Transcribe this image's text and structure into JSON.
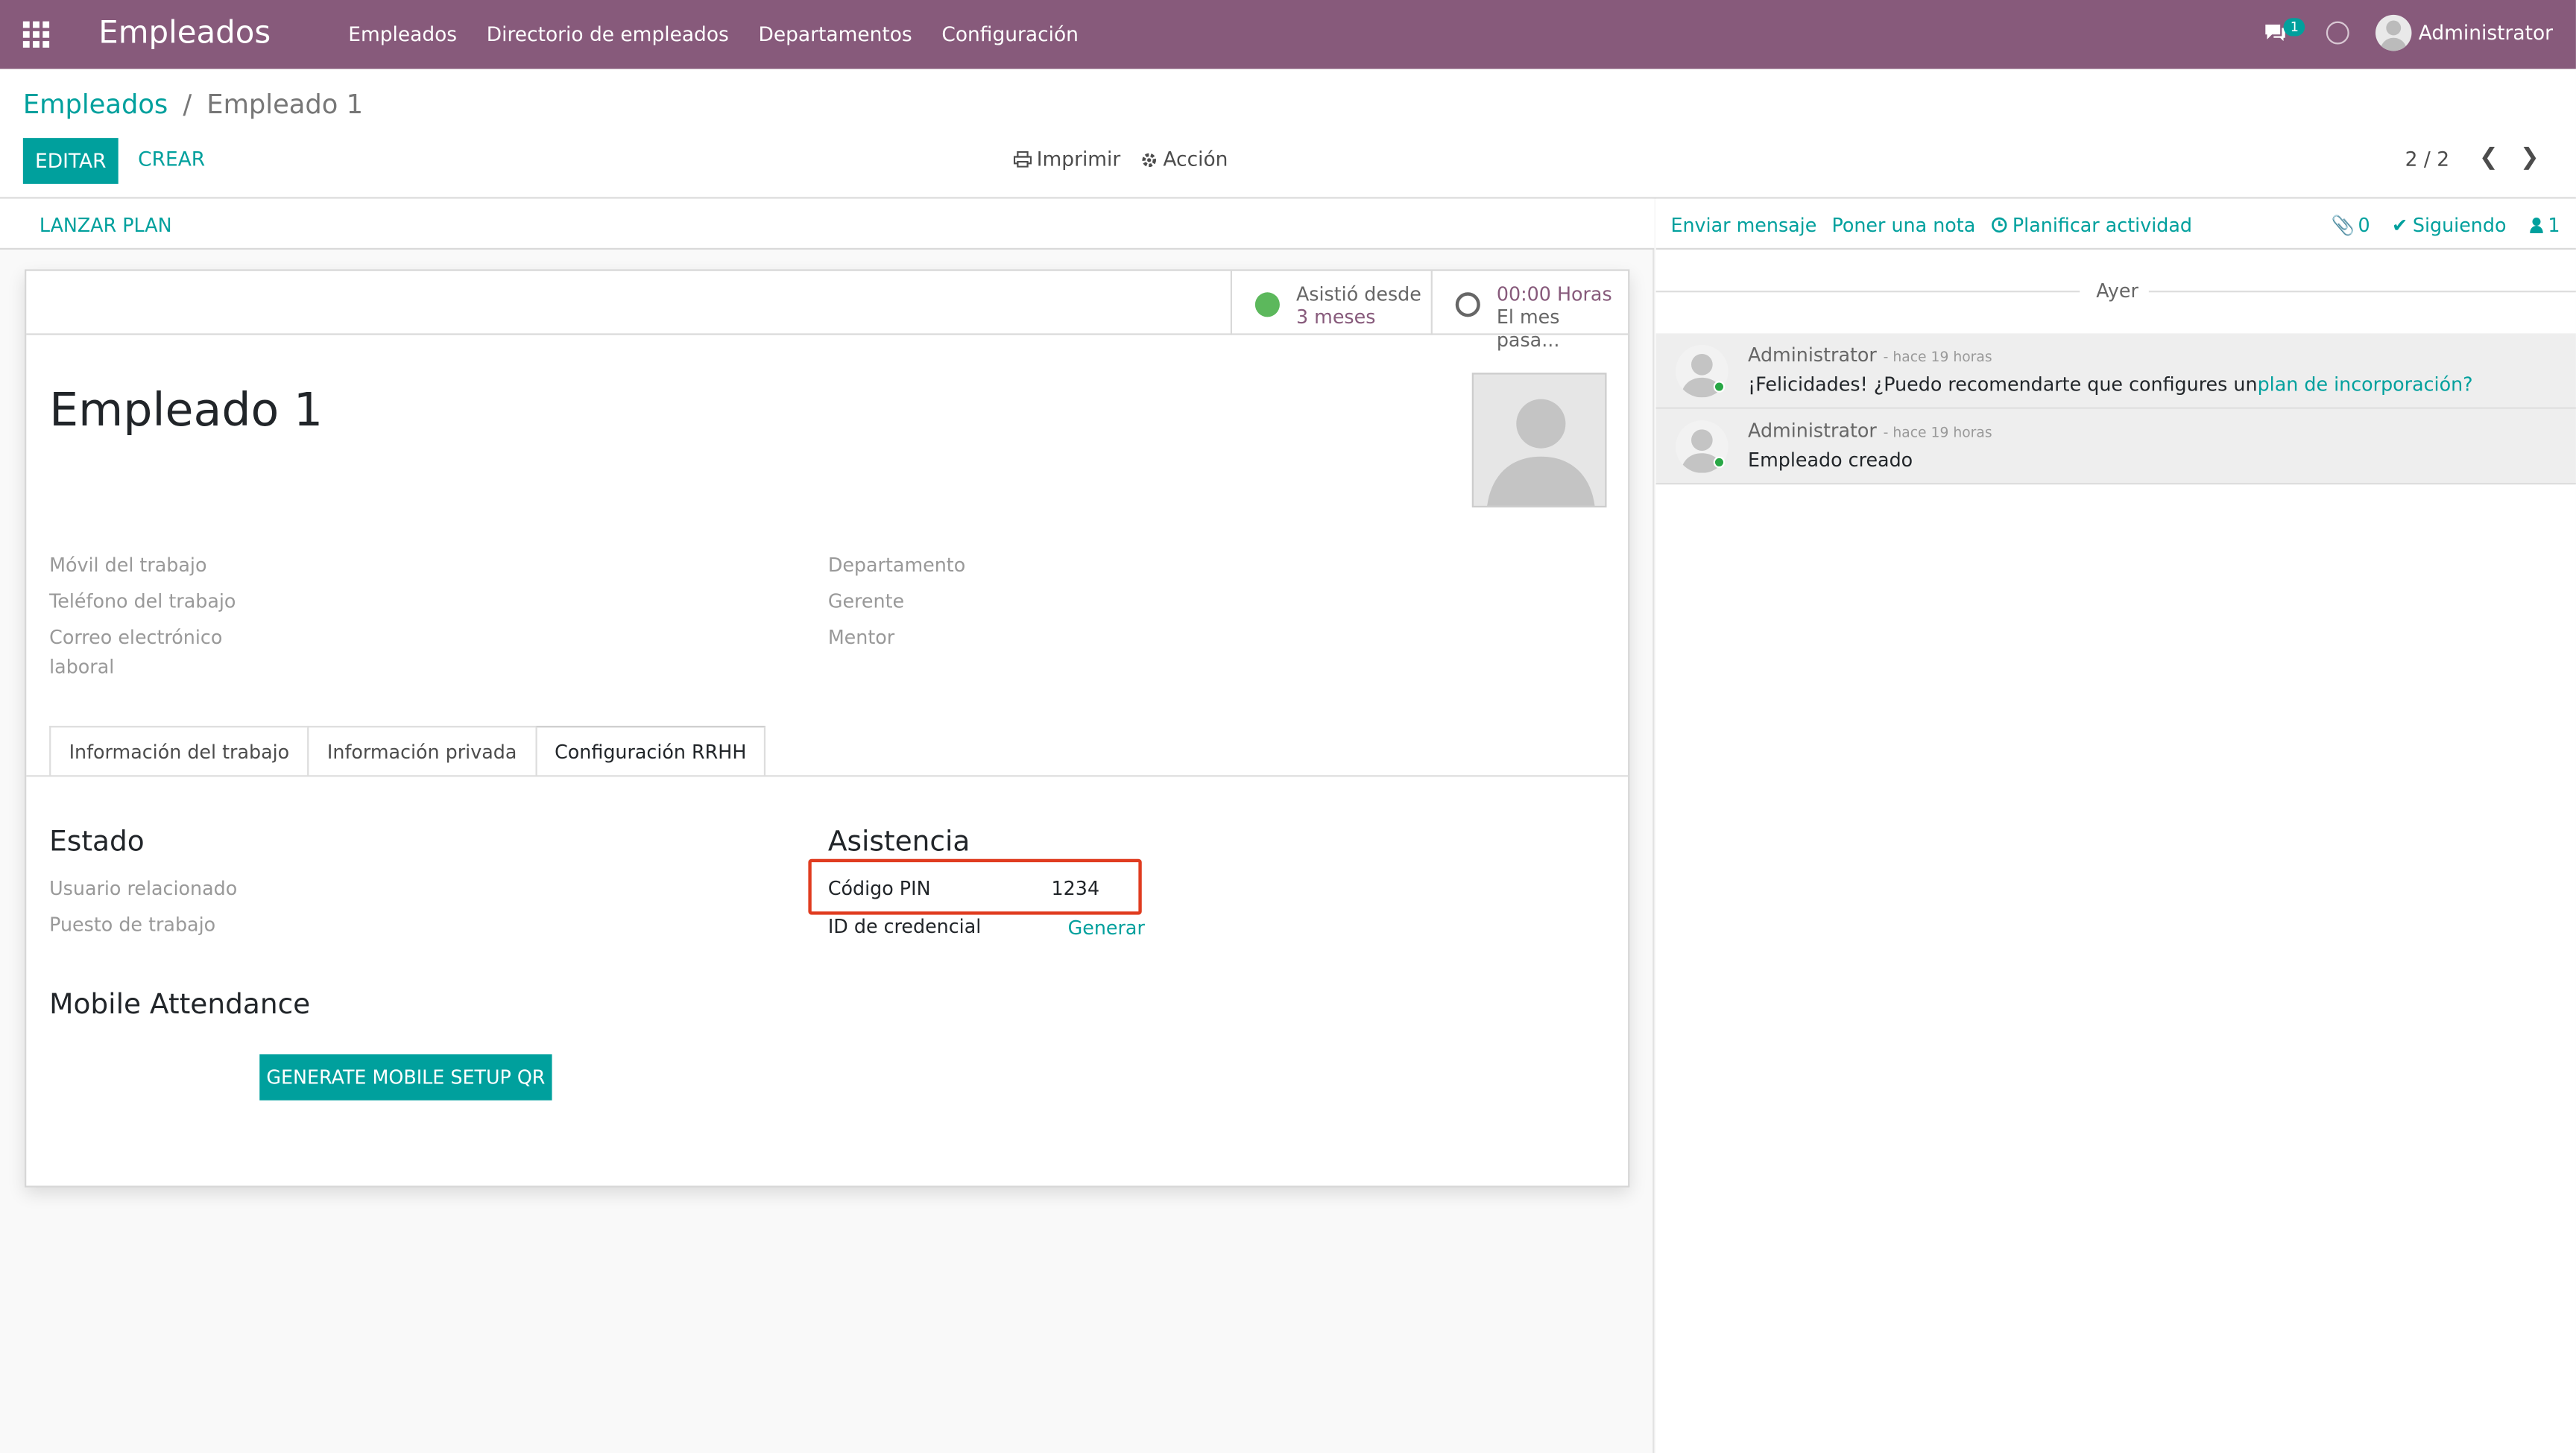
{
  "navbar": {
    "app_title": "Empleados",
    "menu": [
      "Empleados",
      "Directorio de empleados",
      "Departamentos",
      "Configuración"
    ],
    "messages_badge": "1",
    "user": "Administrator",
    "color": "#875a7b"
  },
  "control": {
    "breadcrumb_parent": "Empleados",
    "breadcrumb_sep": "/",
    "breadcrumb_current": "Empleado 1",
    "edit_label": "EDITAR",
    "create_label": "CREAR",
    "print_label": "Imprimir",
    "action_label": "Acción",
    "pager": "2 / 2"
  },
  "statusbar": {
    "launch_plan": "LANZAR PLAN"
  },
  "smart_buttons": {
    "attendance_title": "Asistió desde",
    "attendance_value": "3 meses",
    "hours_value": "00:00 Horas",
    "hours_sub": "El mes pasa..."
  },
  "employee": {
    "name": "Empleado 1",
    "labels": {
      "mobile": "Móvil del trabajo",
      "phone": "Teléfono del trabajo",
      "email_1": "Correo electrónico",
      "email_2": "laboral",
      "department": "Departamento",
      "manager": "Gerente",
      "coach": "Mentor"
    }
  },
  "tabs": [
    "Información del trabajo",
    "Información privada",
    "Configuración RRHH"
  ],
  "hr_settings": {
    "status_title": "Estado",
    "related_user": "Usuario relacionado",
    "job_position": "Puesto de trabajo",
    "attendance_title": "Asistencia",
    "pin_label": "Código PIN",
    "pin_value": "1234",
    "badge_label": "ID de credencial",
    "generate_label": "Generar",
    "mobile_attendance_title": "Mobile Attendance",
    "qr_button": "GENERATE MOBILE SETUP QR"
  },
  "chatter": {
    "send_message": "Enviar mensaje",
    "log_note": "Poner una nota",
    "schedule_activity": "Planificar actividad",
    "attachments": "0",
    "following": "Siguiendo",
    "followers": "1",
    "day": "Ayer",
    "messages": [
      {
        "author": "Administrator",
        "ago": "- hace 19 horas",
        "text": "¡Felicidades! ¿Puedo recomendarte que configures un",
        "link": "plan de incorporación?"
      },
      {
        "author": "Administrator",
        "ago": "- hace 19 horas",
        "text": "Empleado creado",
        "link": ""
      }
    ]
  }
}
